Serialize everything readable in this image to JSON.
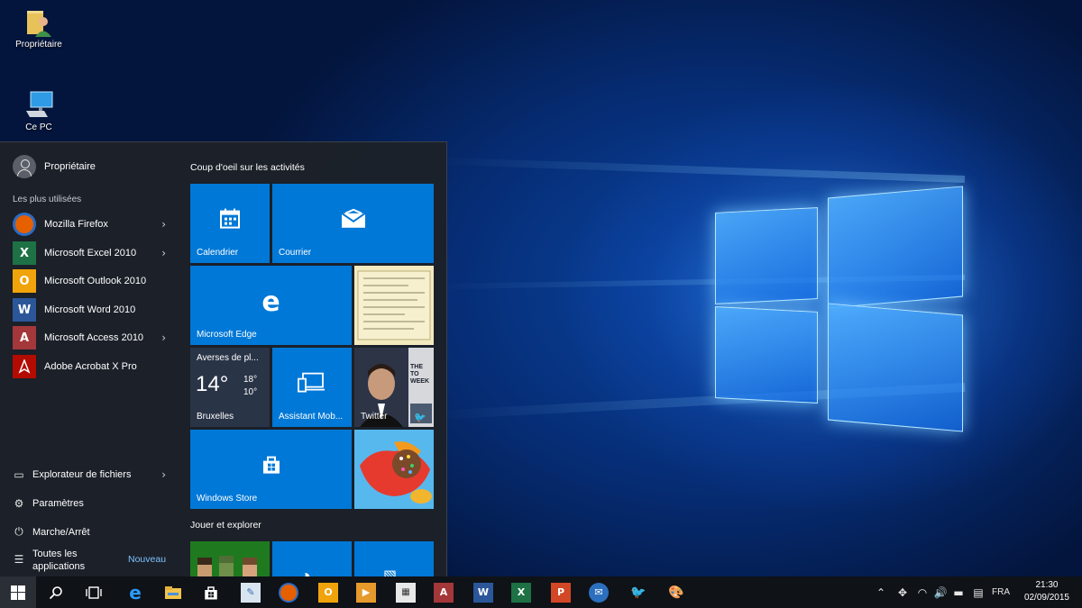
{
  "desktop": {
    "icons": [
      {
        "label": "Propriétaire",
        "icon": "user-folder-icon"
      },
      {
        "label": "Ce PC",
        "icon": "computer-icon"
      }
    ]
  },
  "start_menu": {
    "user_name": "Propriétaire",
    "most_used_label": "Les plus utilisées",
    "most_used": [
      {
        "label": "Mozilla Firefox",
        "icon": "firefox-icon",
        "color": "#e66000",
        "has_submenu": true
      },
      {
        "label": "Microsoft Excel 2010",
        "icon": "excel-icon",
        "color": "#1e7145",
        "has_submenu": true
      },
      {
        "label": "Microsoft Outlook 2010",
        "icon": "outlook-icon",
        "color": "#f0a30a",
        "has_submenu": false
      },
      {
        "label": "Microsoft Word 2010",
        "icon": "word-icon",
        "color": "#2b579a",
        "has_submenu": false
      },
      {
        "label": "Microsoft Access 2010",
        "icon": "access-icon",
        "color": "#a4373a",
        "has_submenu": true
      },
      {
        "label": "Adobe Acrobat X Pro",
        "icon": "acrobat-icon",
        "color": "#b30b00",
        "has_submenu": false
      }
    ],
    "system_items": [
      {
        "label": "Explorateur de fichiers",
        "icon": "folder-icon",
        "has_submenu": true
      },
      {
        "label": "Paramètres",
        "icon": "gear-icon",
        "has_submenu": false
      },
      {
        "label": "Marche/Arrêt",
        "icon": "power-icon",
        "has_submenu": false
      }
    ],
    "all_apps": {
      "line1": "Toutes les",
      "line2": "applications",
      "badge": "Nouveau"
    },
    "groups": [
      {
        "title": "Coup d'oeil sur les activités"
      },
      {
        "title": "Jouer et explorer"
      }
    ],
    "tiles": {
      "calendar": "Calendrier",
      "mail": "Courrier",
      "edge": "Microsoft Edge",
      "weather": {
        "title": "Averses de pl...",
        "temp": "14°",
        "high": "18°",
        "low": "10°",
        "city": "Bruxelles"
      },
      "phone": "Assistant Mob...",
      "twitter": "Twitter",
      "news_text": "THE TO WEEK",
      "store": "Windows Store"
    },
    "accent_color": "#0078d7"
  },
  "taskbar": {
    "apps": [
      "edge-icon",
      "file-explorer-icon",
      "store-icon",
      "paint-icon",
      "firefox-icon",
      "outlook-icon",
      "media-player-icon",
      "calculator-icon",
      "access-icon",
      "word-icon",
      "excel-icon",
      "powerpoint-icon",
      "thunderbird-icon",
      "bird-icon",
      "paint-palette-icon"
    ],
    "language": "FRA",
    "time": "21:30",
    "date": "02/09/2015"
  }
}
